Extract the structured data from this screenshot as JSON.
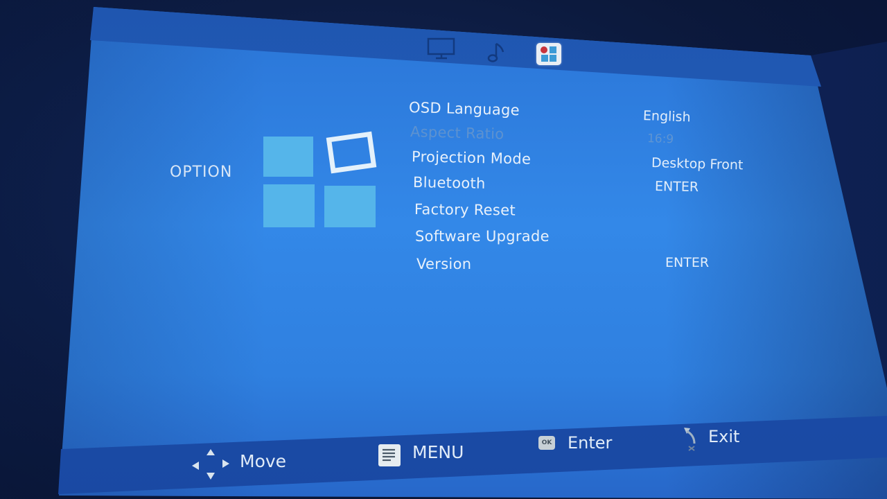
{
  "tabs": [
    {
      "name": "picture",
      "icon": "monitor-icon",
      "active": false
    },
    {
      "name": "sound",
      "icon": "music-note-icon",
      "active": false
    },
    {
      "name": "option",
      "icon": "option-grid-icon",
      "active": true
    }
  ],
  "section": {
    "title": "OPTION",
    "icon": "option-windows-icon"
  },
  "menu": {
    "items": [
      {
        "label": "OSD Language",
        "value": "English",
        "enabled": true
      },
      {
        "label": "Aspect Ratio",
        "value": "16:9",
        "enabled": false
      },
      {
        "label": "Projection Mode",
        "value": "Desktop Front",
        "enabled": true
      },
      {
        "label": "Bluetooth",
        "value": "ENTER",
        "enabled": true
      },
      {
        "label": "Factory Reset",
        "value": "",
        "enabled": true
      },
      {
        "label": "Software Upgrade",
        "value": "",
        "enabled": true
      },
      {
        "label": "Version",
        "value": "ENTER",
        "enabled": true
      }
    ]
  },
  "hints": [
    {
      "icon": "dpad-arrows-icon",
      "label": "Move"
    },
    {
      "icon": "menu-icon",
      "label": "MENU"
    },
    {
      "icon": "ok-button-icon",
      "label": "Enter",
      "icon_text": "OK"
    },
    {
      "icon": "return-arrow-icon",
      "label": "Exit"
    }
  ],
  "colors": {
    "screen_blue": "#3388e8",
    "bar_blue": "#1d51b0",
    "logo_tile": "#55b5ea",
    "text": "#e8f1fb",
    "disabled_text": "#5d92d0",
    "surround": "#0c1a3e"
  }
}
